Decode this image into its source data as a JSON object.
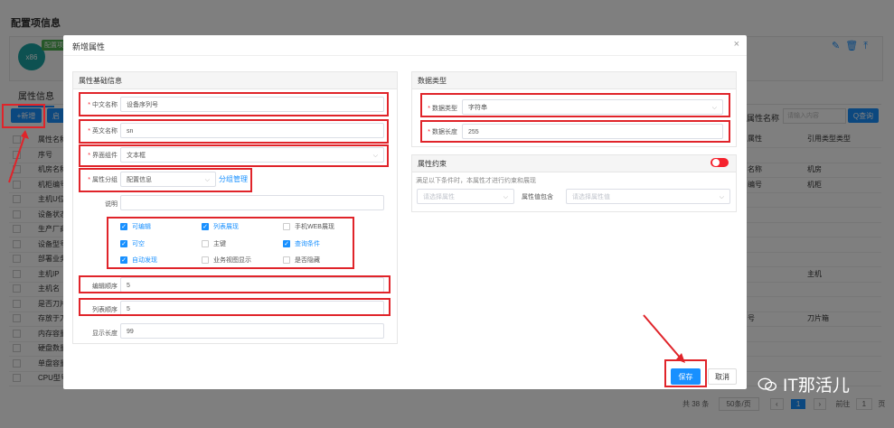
{
  "background": {
    "page_title": "配置项信息",
    "logo_text": "x86",
    "badge_text": "配置项",
    "tab_label": "属性信息",
    "add_button": "+新增",
    "other_button": "启",
    "search_label": "属性名称",
    "search_placeholder": "请输入内容",
    "query_button": "Q查询",
    "col_header_mid": "属性",
    "col_header_right": "引用类型类型",
    "rows": [
      {
        "c1": "属性名称",
        "c2": "",
        "c3": ""
      },
      {
        "c1": "序号",
        "c2": "",
        "c3": ""
      },
      {
        "c1": "机房名称",
        "c2": "名称",
        "c3": "机房"
      },
      {
        "c1": "机柜编号",
        "c2": "编号",
        "c3": "机柜"
      },
      {
        "c1": "主机U位",
        "c2": "",
        "c3": ""
      },
      {
        "c1": "设备状态",
        "c2": "",
        "c3": ""
      },
      {
        "c1": "生产厂商",
        "c2": "",
        "c3": ""
      },
      {
        "c1": "设备型号",
        "c2": "",
        "c3": ""
      },
      {
        "c1": "部署业务",
        "c2": "",
        "c3": ""
      },
      {
        "c1": "主机IP",
        "c2": "",
        "c3": "主机"
      },
      {
        "c1": "主机名",
        "c2": "",
        "c3": ""
      },
      {
        "c1": "是否刀片",
        "c2": "",
        "c3": ""
      },
      {
        "c1": "存放于刀片",
        "c2": "号",
        "c3": "刀片箱"
      },
      {
        "c1": "内存容量",
        "c2": "",
        "c3": ""
      },
      {
        "c1": "硬盘数量",
        "c2": "",
        "c3": ""
      },
      {
        "c1": "单盘容量",
        "c2": "",
        "c3": ""
      },
      {
        "c1": "CPU型号",
        "c2": "",
        "c3": ""
      }
    ],
    "pager_total": "共 38 条",
    "pager_size": "50条/页",
    "pager_page": "1",
    "pager_goto": "前往",
    "pager_goto_value": "1",
    "pager_unit": "页"
  },
  "dialog": {
    "title": "新增属性",
    "close_icon": "×",
    "basic": {
      "title": "属性基础信息",
      "cn_name_label": "中文名称",
      "cn_name_value": "设备序列号",
      "en_name_label": "英文名称",
      "en_name_value": "sn",
      "component_label": "界面组件",
      "component_value": "文本框",
      "group_label": "属性分组",
      "group_value": "配置信息",
      "group_manage": "分组管理",
      "desc_label": "说明",
      "desc_value": "",
      "checkboxes": [
        {
          "label": "可编辑",
          "checked": true
        },
        {
          "label": "列表展现",
          "checked": true
        },
        {
          "label": "手机WEB展现",
          "checked": false
        },
        {
          "label": "可空",
          "checked": true
        },
        {
          "label": "主键",
          "checked": false
        },
        {
          "label": "查询条件",
          "checked": true
        },
        {
          "label": "自动发现",
          "checked": true
        },
        {
          "label": "业务视图显示",
          "checked": false
        },
        {
          "label": "是否隐藏",
          "checked": false
        }
      ],
      "edit_order_label": "编辑顺序",
      "edit_order_value": "5",
      "list_order_label": "列表顺序",
      "list_order_value": "5",
      "display_length_label": "显示长度",
      "display_length_value": "99"
    },
    "datatype": {
      "title": "数据类型",
      "type_label": "数据类型",
      "type_value": "字符串",
      "length_label": "数据长度",
      "length_value": "255"
    },
    "constraint": {
      "title": "属性约束",
      "description": "满足以下条件时，本属性才进行约束和展现",
      "select1_placeholder": "请选择属性",
      "contains_label": "属性值包含",
      "select2_placeholder": "请选择属性值",
      "switch_on": true
    },
    "save_button": "保存",
    "cancel_button": "取消"
  },
  "watermark": "IT那活儿",
  "colors": {
    "accent": "#1890ff",
    "annotation_red": "#e0242a",
    "required": "#f5222d"
  }
}
